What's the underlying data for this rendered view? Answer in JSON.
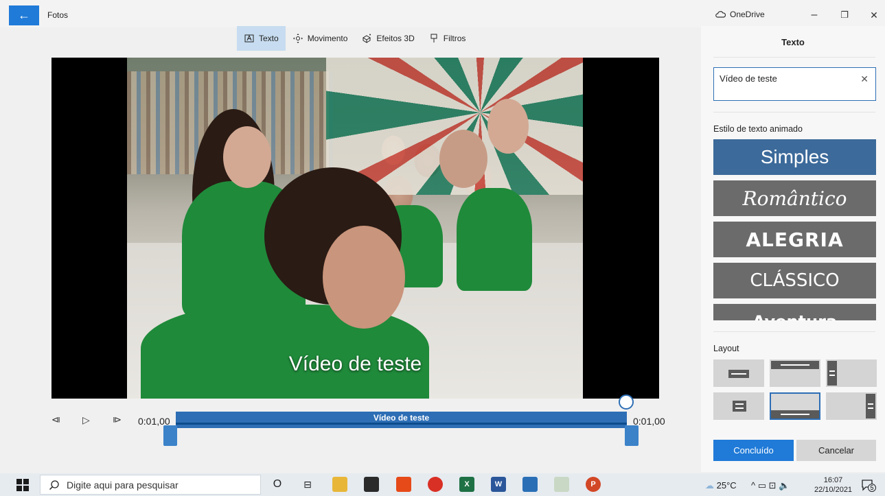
{
  "window": {
    "back_glyph": "←",
    "app_title": "Fotos",
    "onedrive_label": "OneDrive",
    "minimize_glyph": "–",
    "maximize_glyph": "❐",
    "close_glyph": "✕"
  },
  "toolbar": {
    "items": [
      {
        "label": "Texto",
        "icon": "text-icon",
        "active": true
      },
      {
        "label": "Movimento",
        "icon": "motion-icon",
        "active": false
      },
      {
        "label": "Efeitos 3D",
        "icon": "effects-3d-icon",
        "active": false
      },
      {
        "label": "Filtros",
        "icon": "filters-icon",
        "active": false
      }
    ]
  },
  "preview": {
    "caption": "Vídeo de teste"
  },
  "playback": {
    "prev_glyph": "⧏",
    "play_glyph": "▷",
    "next_glyph": "⧐",
    "time_start": "0:01,00",
    "time_end": "0:01,00",
    "track_label": "Vídeo de teste"
  },
  "panel": {
    "title": "Texto",
    "text_value": "Vídeo de teste",
    "clear_glyph": "✕",
    "style_section_label": "Estilo de texto animado",
    "styles": [
      {
        "label": "Simples",
        "selected": true
      },
      {
        "label": "Romântico",
        "selected": false
      },
      {
        "label": "ALEGRIA",
        "selected": false
      },
      {
        "label": "CLÁSSICO",
        "selected": false
      },
      {
        "label": "Aventura",
        "selected": false
      }
    ],
    "layout_section_label": "Layout",
    "layout_selected_index": 4,
    "done_label": "Concluído",
    "cancel_label": "Cancelar"
  },
  "taskbar": {
    "search_placeholder": "Digite aqui para pesquisar",
    "apps": [
      "cortana-icon",
      "task-view-icon",
      "file-explorer-icon",
      "store-icon",
      "office-icon",
      "chrome-icon",
      "excel-icon",
      "word-icon",
      "photos-icon",
      "paint-icon",
      "powerpoint-icon"
    ],
    "weather": "25°C",
    "tray_glyphs": "^ ▭ ⊡ 🔈",
    "time": "16:07",
    "date": "22/10/2021",
    "notifications": "5"
  },
  "colors": {
    "accent": "#1f7ad8",
    "track": "#2d6eb5",
    "selected_style": "#3c6a9a",
    "style_bg": "#6b6b6b"
  }
}
